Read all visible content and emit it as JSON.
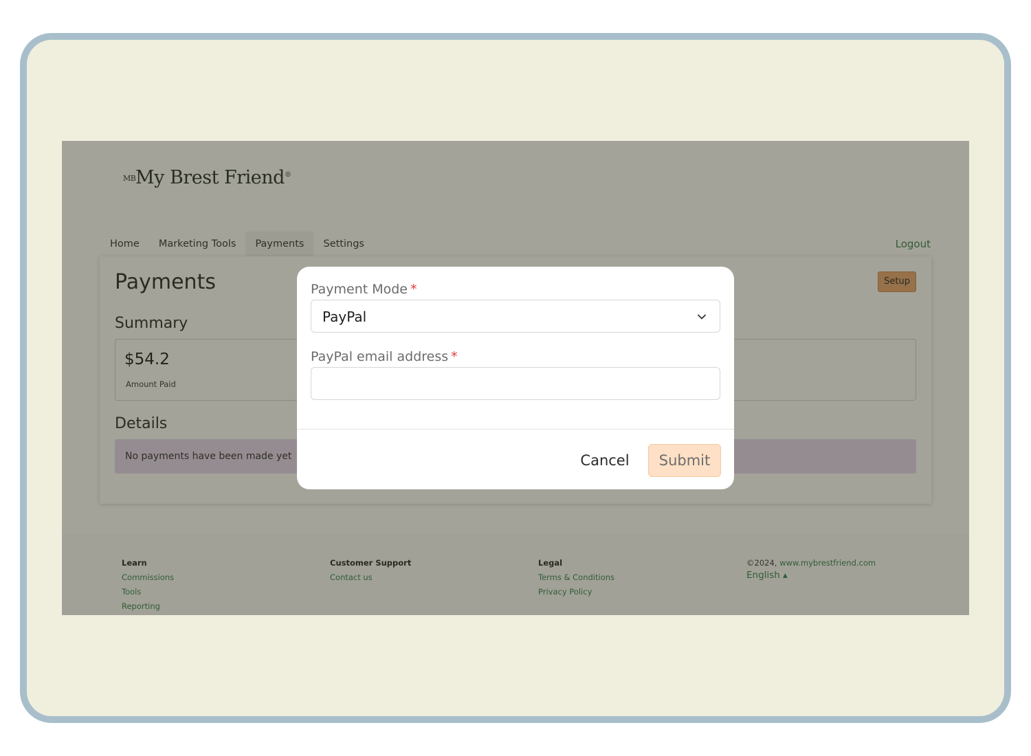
{
  "brand": {
    "logo_mark": "MB",
    "logo_text": "My Brest Friend",
    "logo_reg": "®"
  },
  "nav": {
    "tabs": [
      {
        "label": "Home"
      },
      {
        "label": "Marketing Tools"
      },
      {
        "label": "Payments",
        "active": true
      },
      {
        "label": "Settings"
      }
    ],
    "logout_label": "Logout"
  },
  "page": {
    "title": "Payments",
    "setup_label": "Setup",
    "summary_heading": "Summary",
    "amount_value": "$54.2",
    "amount_label": "Amount Paid",
    "details_heading": "Details",
    "no_payments_text": "No payments have been made yet"
  },
  "footer": {
    "learn": {
      "heading": "Learn",
      "links": [
        "Commissions",
        "Tools",
        "Reporting"
      ]
    },
    "support": {
      "heading": "Customer Support",
      "links": [
        "Contact us"
      ]
    },
    "legal": {
      "heading": "Legal",
      "links": [
        "Terms & Conditions",
        "Privacy Policy"
      ]
    },
    "copyright_prefix": "©2024,",
    "website": "www.mybrestfriend.com",
    "language": "English",
    "language_caret": "▴"
  },
  "modal": {
    "mode_label": "Payment Mode",
    "required_marker": "*",
    "mode_value": "PayPal",
    "email_label": "PayPal email address",
    "email_value": "",
    "email_placeholder": "",
    "cancel_label": "Cancel",
    "submit_label": "Submit"
  },
  "colors": {
    "frame_border": "#a8bfcb",
    "frame_bg": "#f0eedd",
    "link_green": "#2f7d44",
    "setup_button": "#e8a36c",
    "submit_button": "#fde0c5",
    "required_red": "#e23b3b",
    "notice_bg": "#e6d4f0"
  },
  "icons": {
    "select_chevron": "chevron-down-icon",
    "language_caret": "caret-up-icon"
  }
}
